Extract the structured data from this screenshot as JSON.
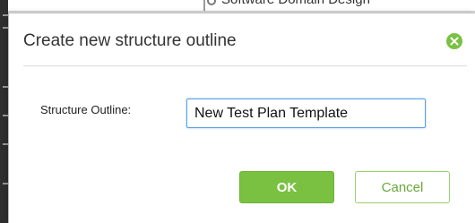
{
  "background": {
    "partial_text": "Software Domain Design"
  },
  "dialog": {
    "title": "Create new structure outline",
    "close_icon": "close-circle-icon",
    "field_label": "Structure Outline:",
    "field_value": "New Test Plan Template",
    "ok_label": "OK",
    "cancel_label": "Cancel"
  },
  "colors": {
    "accent": "#7ac142",
    "input_focus": "#5aa0e6",
    "cancel_text": "#6aa83a"
  }
}
